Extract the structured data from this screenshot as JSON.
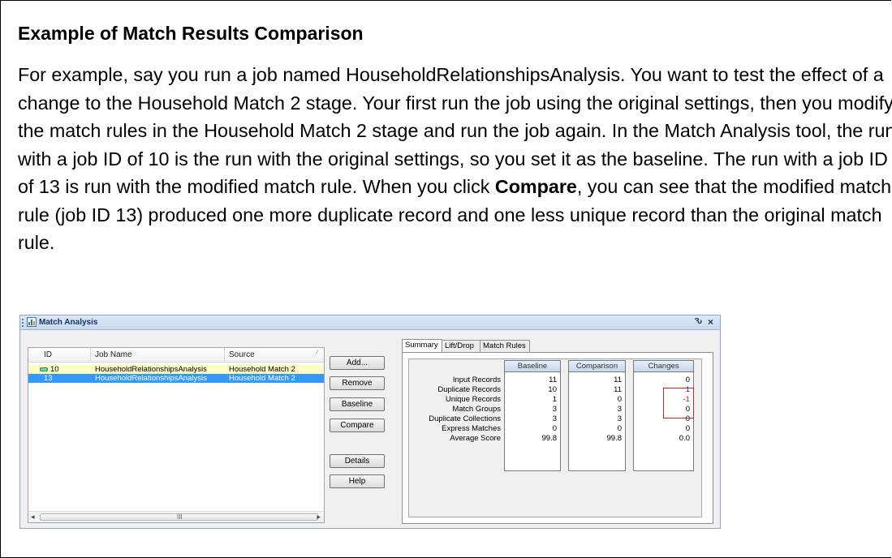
{
  "doc": {
    "title": "Example of Match Results Comparison",
    "para_before": "For example, say you run a job named HouseholdRelationshipsAnalysis. You want to test the effect of a change to the Household Match 2 stage. Your first run the job using the original settings, then you modify the match rules in the Household Match 2 stage and run the job again. In the Match Analysis tool, the run with a job ID of 10 is the run with the original settings, so you set it as the baseline. The run with a job ID of 13 is run with the modified match rule. When you click ",
    "para_bold": "Compare",
    "para_after": ", you can see that the modified match rule (job ID 13) produced one more duplicate record and one less unique record than the original match rule."
  },
  "window": {
    "title": "Match Analysis",
    "pin_glyph": "Ԅ",
    "close_glyph": "×"
  },
  "list": {
    "headers": {
      "id": "ID",
      "job_name": "Job Name",
      "source": "Source"
    },
    "rows": [
      {
        "id": "10",
        "job_name": "HouseholdRelationshipsAnalysis",
        "source": "Household Match 2"
      },
      {
        "id": "13",
        "job_name": "HouseholdRelationshipsAnalysis",
        "source": "Household Match 2"
      }
    ],
    "scroll_grip": "III"
  },
  "buttons": {
    "add": "Add...",
    "remove": "Remove",
    "baseline": "Baseline",
    "compare": "Compare",
    "details": "Details",
    "help": "Help"
  },
  "tabs": [
    "Summary",
    "Lift/Drop",
    "Match Rules"
  ],
  "summary": {
    "columns": [
      "Baseline",
      "Comparison",
      "Changes"
    ],
    "rows": [
      {
        "label": "Input Records",
        "baseline": "11",
        "comparison": "11",
        "changes": "0"
      },
      {
        "label": "Duplicate Records",
        "baseline": "10",
        "comparison": "11",
        "changes": "1"
      },
      {
        "label": "Unique Records",
        "baseline": "1",
        "comparison": "0",
        "changes": "-1"
      },
      {
        "label": "Match Groups",
        "baseline": "3",
        "comparison": "3",
        "changes": "0"
      },
      {
        "label": "Duplicate Collections",
        "baseline": "3",
        "comparison": "3",
        "changes": "0"
      },
      {
        "label": "Express Matches",
        "baseline": "0",
        "comparison": "0",
        "changes": "0"
      },
      {
        "label": "Average Score",
        "baseline": "99.8",
        "comparison": "99.8",
        "changes": "0.0"
      }
    ],
    "colors": {
      "positive": "#1a27c8",
      "negative": "#d11d1d",
      "highlight_box": "#c3262c"
    }
  }
}
